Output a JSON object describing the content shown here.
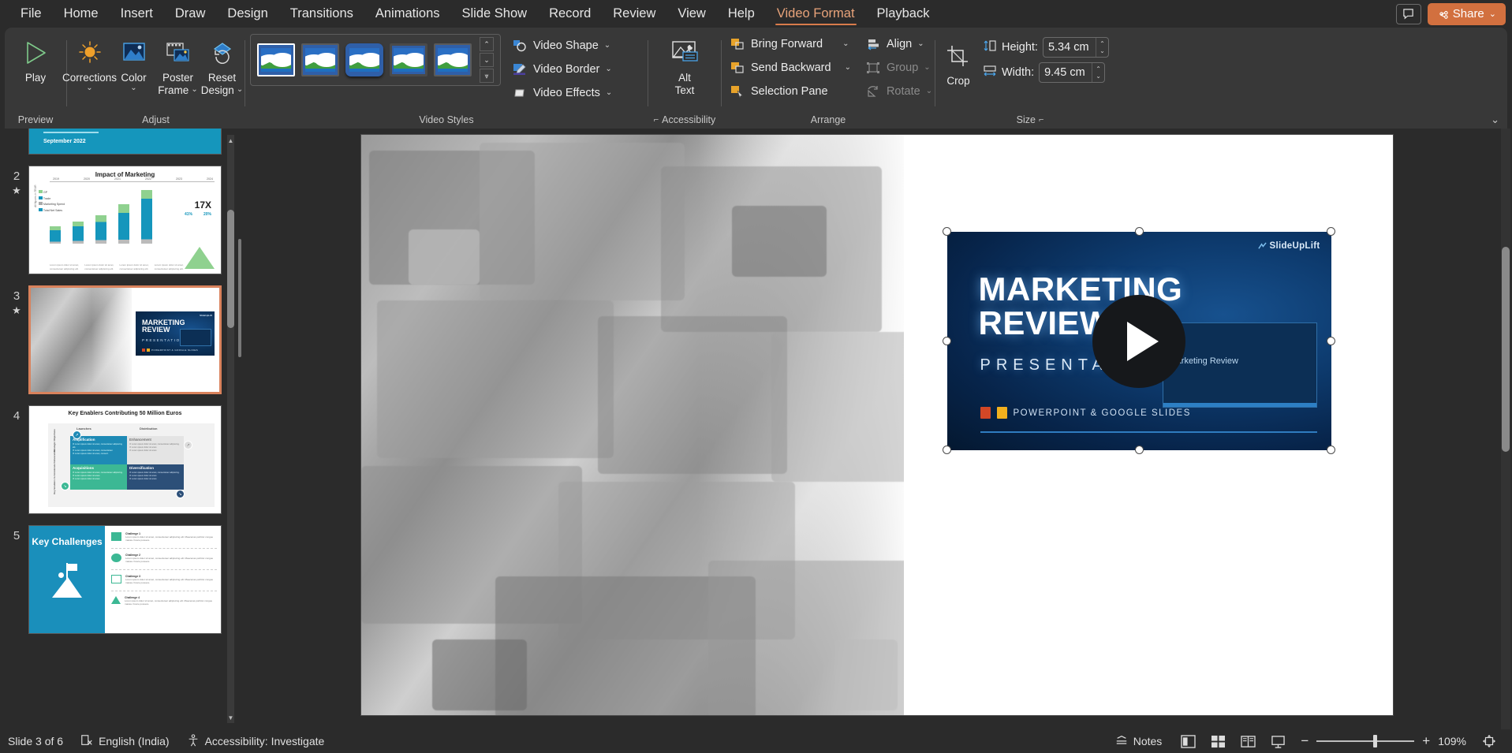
{
  "menu": {
    "items": [
      {
        "label": "File",
        "active": false
      },
      {
        "label": "Home",
        "active": false
      },
      {
        "label": "Insert",
        "active": false
      },
      {
        "label": "Draw",
        "active": false
      },
      {
        "label": "Design",
        "active": false
      },
      {
        "label": "Transitions",
        "active": false
      },
      {
        "label": "Animations",
        "active": false
      },
      {
        "label": "Slide Show",
        "active": false
      },
      {
        "label": "Record",
        "active": false
      },
      {
        "label": "Review",
        "active": false
      },
      {
        "label": "View",
        "active": false
      },
      {
        "label": "Help",
        "active": false
      },
      {
        "label": "Video Format",
        "active": true
      },
      {
        "label": "Playback",
        "active": false
      }
    ],
    "comment_icon": "comment-icon",
    "share_label": "Share",
    "share_caret": "⌄",
    "share_color": "#d2703f"
  },
  "ribbon": {
    "groups": [
      {
        "label": "Preview"
      },
      {
        "label": "Adjust"
      },
      {
        "label": "Video Styles"
      },
      {
        "label": "Accessibility"
      },
      {
        "label": "Arrange"
      },
      {
        "label": "Size"
      }
    ],
    "preview": {
      "play_label": "Play",
      "play_icon": "play-triangle-icon"
    },
    "adjust": {
      "corrections_label": "Corrections",
      "corrections_icon": "brightness-sun-icon",
      "color_label": "Color",
      "color_icon": "color-picture-icon",
      "poster_frame_label": "Poster",
      "poster_frame_label2": "Frame",
      "poster_frame_icon": "film-frame-icon",
      "reset_label": "Reset",
      "reset_label2": "Design",
      "reset_icon": "reset-design-icon",
      "caret": "⌄"
    },
    "video_styles": {
      "thumbs": [
        "style-simple-frame",
        "style-beveled",
        "style-rounded",
        "style-dark-border",
        "style-drop-shadow"
      ],
      "selected_index": 0,
      "scroll_up": "⌃",
      "scroll_down": "⌄",
      "scroll_more": "⩔",
      "video_shape_label": "Video Shape",
      "video_shape_icon": "shape-circle-icon",
      "video_border_label": "Video Border",
      "video_border_icon": "pencil-border-icon",
      "video_effects_label": "Video Effects",
      "video_effects_icon": "effects-icon",
      "caret": "⌄"
    },
    "accessibility": {
      "alt_text_label": "Alt",
      "alt_text_label2": "Text",
      "alt_text_icon": "alt-text-picture-icon",
      "dialog_launcher": "⌐"
    },
    "arrange": {
      "bring_forward_label": "Bring Forward",
      "bring_forward_icon": "bring-forward-icon",
      "send_backward_label": "Send Backward",
      "send_backward_icon": "send-backward-icon",
      "selection_pane_label": "Selection Pane",
      "selection_pane_icon": "selection-pane-icon",
      "align_label": "Align",
      "align_icon": "align-icon",
      "group_label": "Group",
      "group_icon": "group-icon",
      "group_disabled": true,
      "rotate_label": "Rotate",
      "rotate_icon": "rotate-icon",
      "rotate_disabled": true,
      "caret": "⌄"
    },
    "size": {
      "crop_label": "Crop",
      "crop_icon": "crop-icon",
      "height_label": "Height:",
      "height_value": "5.34 cm",
      "height_icon": "height-arrow-icon",
      "width_label": "Width:",
      "width_value": "9.45 cm",
      "width_icon": "width-arrow-icon",
      "spin_up": "⌃",
      "spin_down": "⌄",
      "dialog_launcher": "⌐"
    },
    "collapse_icon": "⌄"
  },
  "thumbnails": {
    "slides": [
      {
        "number": "1",
        "starred": false,
        "title": "September 2022",
        "kind": "title-banner"
      },
      {
        "number": "2",
        "starred": true,
        "title": "Impact of Marketing",
        "kind": "chart",
        "legend": [
          "GP",
          "Trade",
          "Marketing Spend",
          "Total Net Sales"
        ],
        "years": [
          "2019",
          "2020",
          "2021",
          "2022",
          "2023",
          "2024"
        ],
        "callout_big": "17X",
        "callout_sub1": "41%",
        "callout_sub2": "20%",
        "axis_label": "All figures in TEUR"
      },
      {
        "number": "3",
        "starred": true,
        "title": "MARKETING REVIEW",
        "subtitle": "PRESENTATION",
        "kind": "video-slide",
        "selected": true
      },
      {
        "number": "4",
        "starred": false,
        "title": "Key Enablers Contributing 50 Million Euros",
        "kind": "matrix",
        "cols": [
          "Launches",
          "Distribution"
        ],
        "rows": [
          "Strategic Objectives",
          "Key Enablers to Accelerate Deliverables"
        ],
        "cells": [
          "Amplification",
          "Enhancement",
          "Acquisitions",
          "Diversification"
        ]
      },
      {
        "number": "5",
        "starred": false,
        "title": "Key Challenges",
        "kind": "challenges",
        "items": [
          "Challenge 1",
          "Challenge 2",
          "Challenge 3",
          "Challenge 4"
        ],
        "body": "Lorem ipsum dolor sit amet, consectetuer adipiscing elit. Maecenas porttitor congue massa. Fusce posuere."
      }
    ]
  },
  "slide": {
    "video": {
      "title_line1": "MARKETING",
      "title_line2": "REVIEW",
      "subtitle": "PRESENTATION",
      "footer_text": "POWERPOINT & GOOGLE SLIDES",
      "logo": "SlideUpLift",
      "laptop_caption": "Marketing Review",
      "play_icon": "play-button-icon",
      "selected": true
    }
  },
  "statusbar": {
    "slide_counter": "Slide 3 of 6",
    "accessibility_text": "Accessibility: Investigate",
    "accessibility_icon": "accessibility-person-icon",
    "language": "English (India)",
    "language_icon": "spellcheck-icon",
    "notes_label": "Notes",
    "notes_icon": "notes-caret-icon",
    "views": [
      "normal-view-icon",
      "slide-sorter-icon",
      "reading-view-icon",
      "slideshow-icon"
    ],
    "zoom_out": "−",
    "zoom_in": "+",
    "zoom_level": "109%",
    "fit_icon": "fit-to-window-icon"
  }
}
